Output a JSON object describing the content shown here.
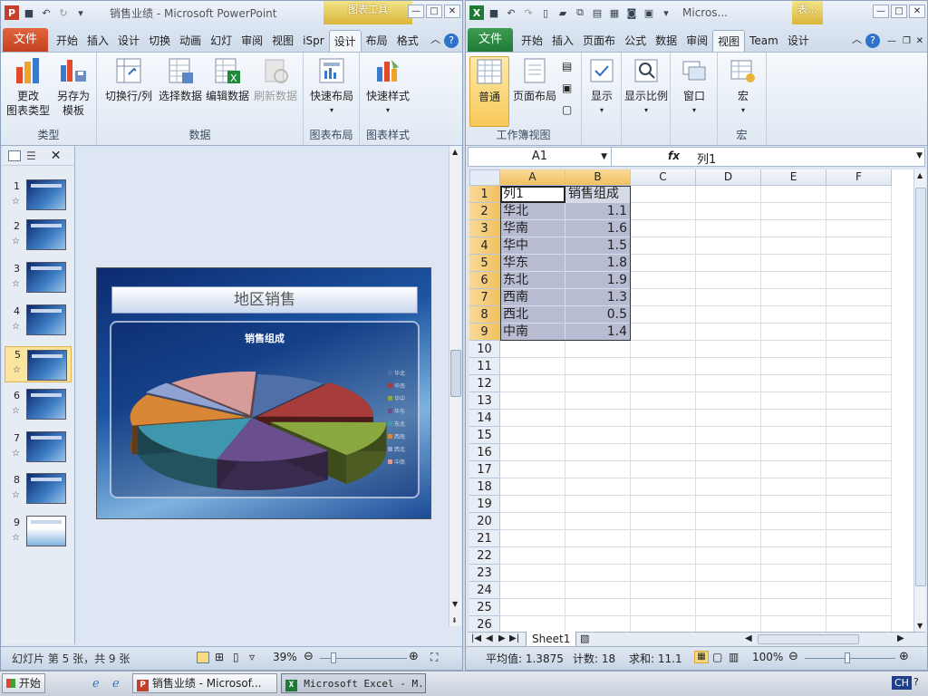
{
  "ppt": {
    "title": "销售业绩 - Microsoft PowerPoint",
    "context_tab": "图表工具",
    "file_tab": "文件",
    "tabs": [
      "开始",
      "插入",
      "设计",
      "切换",
      "动画",
      "幻灯",
      "审阅",
      "视图",
      "iSpr",
      "设计",
      "布局",
      "格式"
    ],
    "ribbon": {
      "groups": [
        {
          "label": "类型",
          "buttons": [
            "更改\n图表类型",
            "另存为\n模板"
          ]
        },
        {
          "label": "数据",
          "buttons": [
            "切换行/列",
            "选择数据",
            "编辑数据",
            "刷新数据"
          ]
        },
        {
          "label": "图表布局",
          "buttons": [
            "快速布局"
          ]
        },
        {
          "label": "图表样式",
          "buttons": [
            "快速样式"
          ]
        }
      ]
    },
    "thumb_numbers": [
      "1",
      "2",
      "3",
      "4",
      "5",
      "6",
      "7",
      "8",
      "9"
    ],
    "slide": {
      "title": "地区销售",
      "chart_title": "销售组成"
    },
    "status": {
      "slide_info": "幻灯片 第 5 张，共 9 张",
      "zoom": "39%"
    }
  },
  "excel": {
    "title": "Micros...",
    "context_tab": "表...",
    "file_tab": "文件",
    "tabs": [
      "开始",
      "插入",
      "页面布",
      "公式",
      "数据",
      "审阅",
      "视图",
      "Team",
      "设计"
    ],
    "ribbon": {
      "groups": [
        {
          "label": "工作簿视图",
          "buttons": [
            "普通",
            "页面布局"
          ]
        },
        {
          "label": "",
          "buttons": [
            "显示",
            "显示比例",
            "窗口"
          ]
        },
        {
          "label": "宏",
          "buttons": [
            "宏"
          ]
        }
      ]
    },
    "name_box": "A1",
    "fx": "fx",
    "formula": "列1",
    "columns": [
      "A",
      "B",
      "C",
      "D",
      "E",
      "F"
    ],
    "rows": [
      "1",
      "2",
      "3",
      "4",
      "5",
      "6",
      "7",
      "8",
      "9",
      "10",
      "11",
      "12",
      "13",
      "14",
      "15",
      "16",
      "17",
      "18",
      "19",
      "20",
      "21",
      "22",
      "23",
      "24",
      "25",
      "26"
    ],
    "cells": [
      [
        "列1",
        "销售组成"
      ],
      [
        "华北",
        "1.1"
      ],
      [
        "华南",
        "1.6"
      ],
      [
        "华中",
        "1.5"
      ],
      [
        "华东",
        "1.8"
      ],
      [
        "东北",
        "1.9"
      ],
      [
        "西南",
        "1.3"
      ],
      [
        "西北",
        "0.5"
      ],
      [
        "中南",
        "1.4"
      ]
    ],
    "sheet_tab": "Sheet1",
    "status": {
      "average": "平均值: 1.3875",
      "count": "计数: 18",
      "sum": "求和: 11.1",
      "zoom": "100%"
    }
  },
  "taskbar": {
    "start": "开始",
    "items": [
      "销售业绩 - Microsof...",
      "Microsoft Excel - M..."
    ],
    "lang": "CH"
  },
  "chart_data": {
    "type": "pie",
    "title": "销售组成",
    "categories": [
      "华北",
      "华南",
      "华中",
      "华东",
      "东北",
      "西南",
      "西北",
      "中南"
    ],
    "values": [
      1.1,
      1.6,
      1.5,
      1.8,
      1.9,
      1.3,
      0.5,
      1.4
    ],
    "colors": [
      "#4f6fa8",
      "#a83c3a",
      "#8aa83f",
      "#6a4f8e",
      "#3f97ad",
      "#d98637",
      "#8ea3d3",
      "#d79c9a"
    ],
    "legend": "right"
  }
}
